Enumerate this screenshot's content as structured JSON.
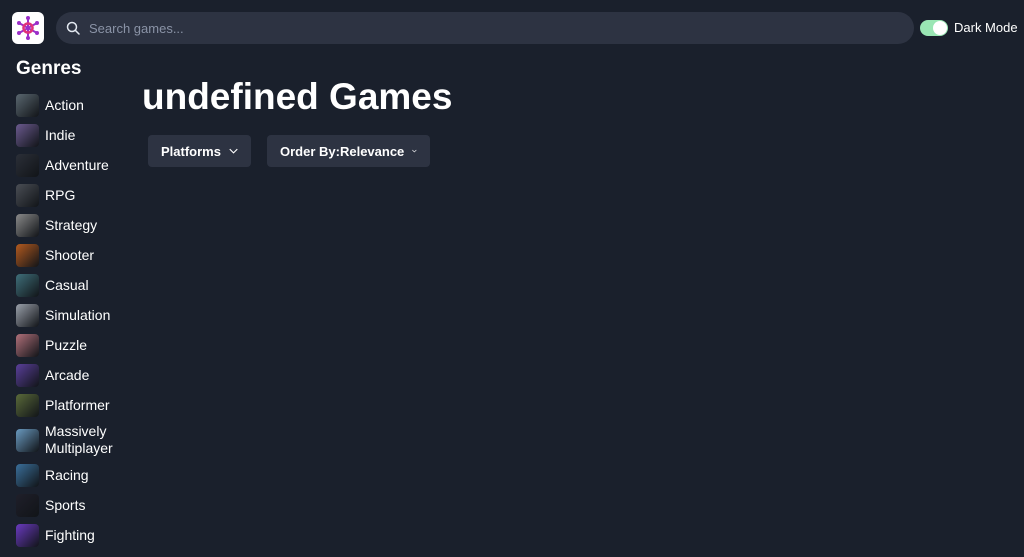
{
  "navbar": {
    "logo_icon": "network-hub-logo",
    "search_placeholder": "Search games...",
    "dark_mode_label": "Dark Mode",
    "dark_mode_on": true
  },
  "sidebar": {
    "title": "Genres",
    "genres": [
      {
        "label": "Action",
        "color": "#5a6770"
      },
      {
        "label": "Indie",
        "color": "#6b5a8f"
      },
      {
        "label": "Adventure",
        "color": "#2b2f38"
      },
      {
        "label": "RPG",
        "color": "#4a4e55"
      },
      {
        "label": "Strategy",
        "color": "#8a8a8a"
      },
      {
        "label": "Shooter",
        "color": "#b35a1f"
      },
      {
        "label": "Casual",
        "color": "#3f6f7a"
      },
      {
        "label": "Simulation",
        "color": "#9aa0aa"
      },
      {
        "label": "Puzzle",
        "color": "#b0707a"
      },
      {
        "label": "Arcade",
        "color": "#5a3f9a"
      },
      {
        "label": "Platformer",
        "color": "#5a6a3a"
      },
      {
        "label": "Massively Multiplayer",
        "color": "#6a9ac0"
      },
      {
        "label": "Racing",
        "color": "#3a6f9a"
      },
      {
        "label": "Sports",
        "color": "#1f1f2a"
      },
      {
        "label": "Fighting",
        "color": "#6a3ac0"
      }
    ]
  },
  "main": {
    "heading": "undefined Games",
    "platforms_label": "Platforms",
    "order_label": "Order By:Relevance"
  },
  "colors": {
    "background": "#1a202c",
    "surface": "#2d3342",
    "toggle_on": "#9ae6b4"
  }
}
